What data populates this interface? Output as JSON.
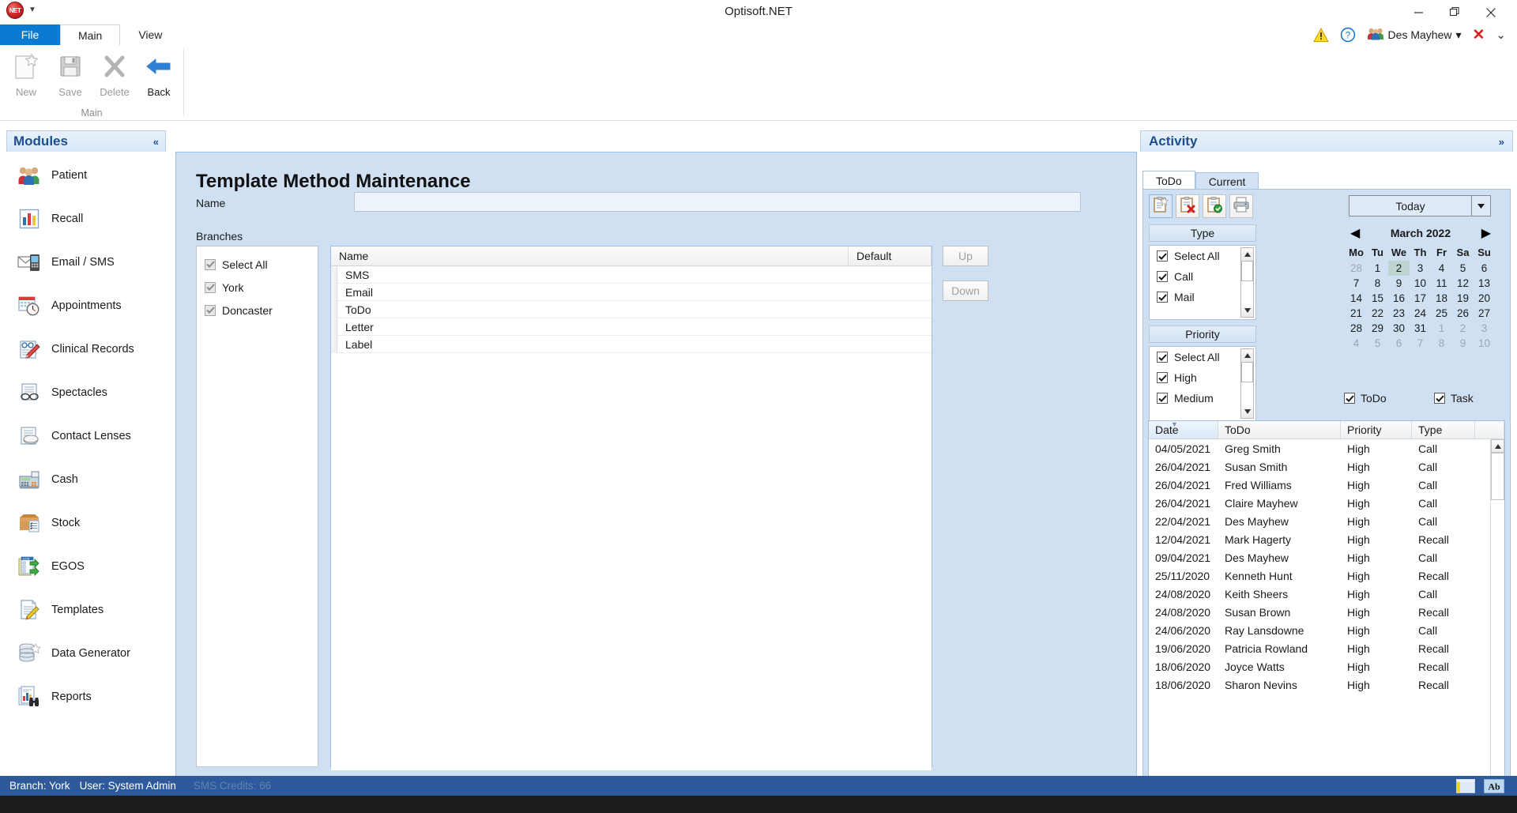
{
  "window": {
    "title": "Optisoft.NET",
    "logo_text": "NET",
    "minimize": "minimize-icon",
    "maximize": "maximize-icon",
    "close": "close-icon"
  },
  "ribbon": {
    "tabs": [
      {
        "label": "File",
        "state": "file"
      },
      {
        "label": "Main",
        "state": "active"
      },
      {
        "label": "View",
        "state": "normal"
      }
    ],
    "right_icons": {
      "warning": "warning-icon",
      "help": "help-icon",
      "user_icon": "users-icon",
      "user_name": "Des Mayhew",
      "user_caret": "▾",
      "close_red": "✕",
      "collapse": "⌄"
    },
    "group_title": "Main",
    "buttons": [
      {
        "label": "New",
        "enabled": false,
        "icon": "new-page-icon"
      },
      {
        "label": "Save",
        "enabled": false,
        "icon": "floppy-disk-icon"
      },
      {
        "label": "Delete",
        "enabled": false,
        "icon": "x-cross-icon"
      },
      {
        "label": "Back",
        "enabled": true,
        "icon": "back-arrow-icon"
      }
    ]
  },
  "sidebar": {
    "title": "Modules",
    "collapse_label": "«",
    "items": [
      {
        "label": "Patient",
        "icon": "patients-group-icon"
      },
      {
        "label": "Recall",
        "icon": "bar-chart-icon"
      },
      {
        "label": "Email / SMS",
        "icon": "envelope-phone-icon"
      },
      {
        "label": "Appointments",
        "icon": "calendar-clock-icon"
      },
      {
        "label": "Clinical Records",
        "icon": "clinical-pencil-icon"
      },
      {
        "label": "Spectacles",
        "icon": "glasses-document-icon"
      },
      {
        "label": "Contact Lenses",
        "icon": "contact-lens-icon"
      },
      {
        "label": "Cash",
        "icon": "cash-register-icon"
      },
      {
        "label": "Stock",
        "icon": "stock-box-icon"
      },
      {
        "label": "EGOS",
        "icon": "egos-form-icon"
      },
      {
        "label": "Templates",
        "icon": "template-pencil-icon"
      },
      {
        "label": "Data Generator",
        "icon": "database-star-icon"
      },
      {
        "label": "Reports",
        "icon": "reports-binoculars-icon"
      }
    ]
  },
  "main": {
    "title": "Template Method Maintenance",
    "name_label": "Name",
    "name_value": "",
    "name_placeholder": "",
    "branches_label": "Branches",
    "branches": [
      {
        "label": "Select All",
        "checked": true,
        "disabled": true
      },
      {
        "label": "York",
        "checked": true,
        "disabled": true
      },
      {
        "label": "Doncaster",
        "checked": true,
        "disabled": true
      }
    ],
    "grid": {
      "columns": [
        "Name",
        "Default"
      ],
      "rows": [
        {
          "name": "SMS",
          "default": ""
        },
        {
          "name": "Email",
          "default": ""
        },
        {
          "name": "ToDo",
          "default": ""
        },
        {
          "name": "Letter",
          "default": ""
        },
        {
          "name": "Label",
          "default": ""
        }
      ]
    },
    "move_buttons": [
      {
        "label": "Up",
        "enabled": false
      },
      {
        "label": "Down",
        "enabled": false
      }
    ]
  },
  "activity": {
    "title": "Activity",
    "expand_label": "»",
    "tabs": [
      {
        "label": "ToDo",
        "active": true
      },
      {
        "label": "Current",
        "active": false
      }
    ],
    "toolbar": [
      {
        "icon": "new-todo-icon",
        "selected": true
      },
      {
        "icon": "delete-todo-icon",
        "selected": false
      },
      {
        "icon": "complete-todo-icon",
        "selected": false
      },
      {
        "icon": "print-icon",
        "selected": false
      }
    ],
    "type_group": {
      "header": "Type",
      "items": [
        {
          "label": "Select All",
          "checked": true
        },
        {
          "label": "Call",
          "checked": true
        },
        {
          "label": "Mail",
          "checked": true
        }
      ]
    },
    "priority_group": {
      "header": "Priority",
      "items": [
        {
          "label": "Select All",
          "checked": true
        },
        {
          "label": "High",
          "checked": true
        },
        {
          "label": "Medium",
          "checked": true
        }
      ]
    },
    "today_button": "Today",
    "calendar": {
      "month_label": "March 2022",
      "prev": "◀",
      "next": "▶",
      "day_headers": [
        "Mo",
        "Tu",
        "We",
        "Th",
        "Fr",
        "Sa",
        "Su"
      ],
      "weeks": [
        [
          {
            "d": "28",
            "m": "other"
          },
          {
            "d": "1",
            "m": "cur"
          },
          {
            "d": "2",
            "m": "today"
          },
          {
            "d": "3",
            "m": "cur"
          },
          {
            "d": "4",
            "m": "cur"
          },
          {
            "d": "5",
            "m": "cur"
          },
          {
            "d": "6",
            "m": "cur"
          }
        ],
        [
          {
            "d": "7",
            "m": "cur"
          },
          {
            "d": "8",
            "m": "cur"
          },
          {
            "d": "9",
            "m": "cur"
          },
          {
            "d": "10",
            "m": "cur"
          },
          {
            "d": "11",
            "m": "cur"
          },
          {
            "d": "12",
            "m": "cur"
          },
          {
            "d": "13",
            "m": "cur"
          }
        ],
        [
          {
            "d": "14",
            "m": "cur"
          },
          {
            "d": "15",
            "m": "cur"
          },
          {
            "d": "16",
            "m": "cur"
          },
          {
            "d": "17",
            "m": "cur"
          },
          {
            "d": "18",
            "m": "cur"
          },
          {
            "d": "19",
            "m": "cur"
          },
          {
            "d": "20",
            "m": "cur"
          }
        ],
        [
          {
            "d": "21",
            "m": "cur"
          },
          {
            "d": "22",
            "m": "cur"
          },
          {
            "d": "23",
            "m": "cur"
          },
          {
            "d": "24",
            "m": "cur"
          },
          {
            "d": "25",
            "m": "cur"
          },
          {
            "d": "26",
            "m": "cur"
          },
          {
            "d": "27",
            "m": "cur"
          }
        ],
        [
          {
            "d": "28",
            "m": "cur"
          },
          {
            "d": "29",
            "m": "cur"
          },
          {
            "d": "30",
            "m": "cur"
          },
          {
            "d": "31",
            "m": "cur"
          },
          {
            "d": "1",
            "m": "other"
          },
          {
            "d": "2",
            "m": "other"
          },
          {
            "d": "3",
            "m": "other"
          }
        ],
        [
          {
            "d": "4",
            "m": "other"
          },
          {
            "d": "5",
            "m": "other"
          },
          {
            "d": "6",
            "m": "other"
          },
          {
            "d": "7",
            "m": "other"
          },
          {
            "d": "8",
            "m": "other"
          },
          {
            "d": "9",
            "m": "other"
          },
          {
            "d": "10",
            "m": "other"
          }
        ]
      ]
    },
    "bottom_checks": [
      {
        "label": "ToDo",
        "checked": true
      },
      {
        "label": "Task",
        "checked": true
      }
    ],
    "grid": {
      "columns": [
        "Date",
        "ToDo",
        "Priority",
        "Type"
      ],
      "sorted_column": "Date",
      "rows": [
        {
          "date": "04/05/2021",
          "todo": "Greg Smith",
          "priority": "High",
          "type": "Call"
        },
        {
          "date": "26/04/2021",
          "todo": "Susan Smith",
          "priority": "High",
          "type": "Call"
        },
        {
          "date": "26/04/2021",
          "todo": "Fred Williams",
          "priority": "High",
          "type": "Call"
        },
        {
          "date": "26/04/2021",
          "todo": "Claire Mayhew",
          "priority": "High",
          "type": "Call"
        },
        {
          "date": "22/04/2021",
          "todo": "Des Mayhew",
          "priority": "High",
          "type": "Call"
        },
        {
          "date": "12/04/2021",
          "todo": "Mark Hagerty",
          "priority": "High",
          "type": "Recall"
        },
        {
          "date": "09/04/2021",
          "todo": "Des Mayhew",
          "priority": "High",
          "type": "Call"
        },
        {
          "date": "25/11/2020",
          "todo": "Kenneth Hunt",
          "priority": "High",
          "type": "Recall"
        },
        {
          "date": "24/08/2020",
          "todo": "Keith Sheers",
          "priority": "High",
          "type": "Call"
        },
        {
          "date": "24/08/2020",
          "todo": "Susan Brown",
          "priority": "High",
          "type": "Recall"
        },
        {
          "date": "24/06/2020",
          "todo": "Ray Lansdowne",
          "priority": "High",
          "type": "Call"
        },
        {
          "date": "19/06/2020",
          "todo": "Patricia Rowland",
          "priority": "High",
          "type": "Recall"
        },
        {
          "date": "18/06/2020",
          "todo": "Joyce Watts",
          "priority": "High",
          "type": "Recall"
        },
        {
          "date": "18/06/2020",
          "todo": "Sharon Nevins",
          "priority": "High",
          "type": "Recall"
        }
      ]
    }
  },
  "statusbar": {
    "branch": "Branch: York",
    "user": "User: System Admin",
    "sms_credits": "SMS Credits: 66",
    "icons": [
      "window-icon",
      "ab-icon"
    ]
  },
  "colors": {
    "accent_blue": "#0b7ad1",
    "panel_blue": "#cfe0f3",
    "header_blue": "#1b4f8f",
    "status_blue": "#2e5a9c",
    "today_highlight": "#bcd4d2"
  }
}
